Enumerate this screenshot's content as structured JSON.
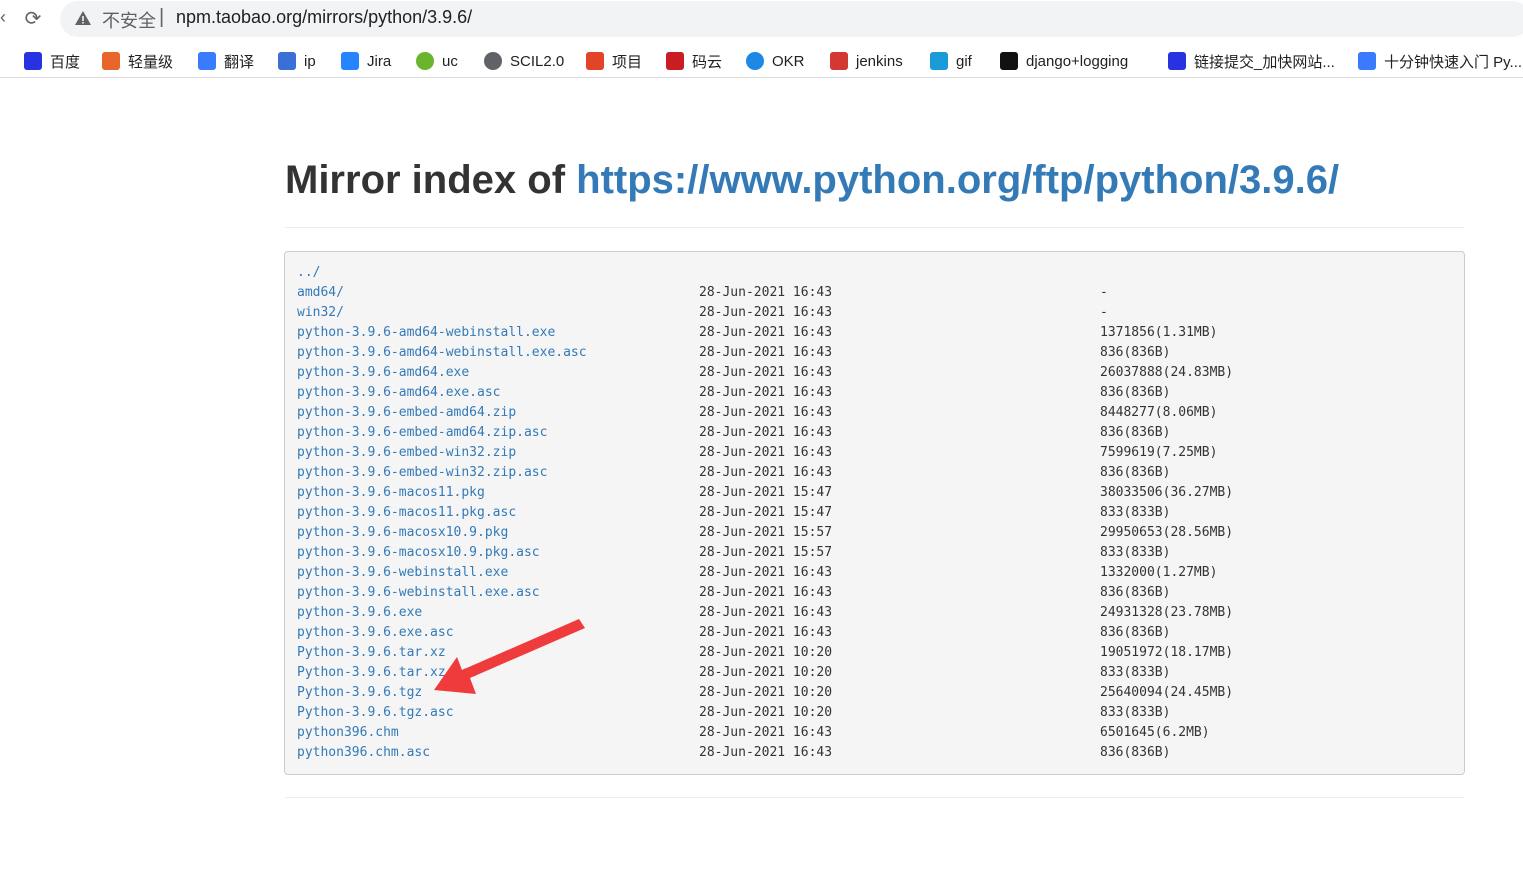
{
  "browser": {
    "security_label": "不安全",
    "address_separator": "|",
    "url": "npm.taobao.org/mirrors/python/3.9.6/"
  },
  "bookmarks": [
    {
      "label": "百度",
      "icon": "baidu-paw-icon",
      "color": "#2932e1"
    },
    {
      "label": "轻量级",
      "icon": "lightweight-icon",
      "color": "#e8652b"
    },
    {
      "label": "翻译",
      "icon": "translate-icon",
      "color": "#3a7bfd"
    },
    {
      "label": "ip",
      "icon": "ip-icon",
      "color": "#3a6fd8"
    },
    {
      "label": "Jira",
      "icon": "jira-icon",
      "color": "#2684ff"
    },
    {
      "label": "uc",
      "icon": "uc-icon",
      "color": "#6ab42e"
    },
    {
      "label": "SCIL2.0",
      "icon": "globe-icon",
      "color": "#5f6368"
    },
    {
      "label": "项目",
      "icon": "gitlab-icon",
      "color": "#e24329"
    },
    {
      "label": "码云",
      "icon": "gitee-icon",
      "color": "#c71d23"
    },
    {
      "label": "OKR",
      "icon": "okr-ring-icon",
      "color": "#1e88e5"
    },
    {
      "label": "jenkins",
      "icon": "jenkins-icon",
      "color": "#d33833"
    },
    {
      "label": "gif",
      "icon": "cloud-mountain-icon",
      "color": "#1a9bd7"
    },
    {
      "label": "django+logging",
      "icon": "django-site-icon",
      "color": "#111111"
    },
    {
      "label": "链接提交_加快网站...",
      "icon": "baidu-paw-icon",
      "color": "#2932e1"
    },
    {
      "label": "十分钟快速入门 Py...",
      "icon": "layers-icon",
      "color": "#3a7bfd"
    }
  ],
  "page": {
    "title_prefix": "Mirror index of",
    "title_link": "https://www.python.org/ftp/python/3.9.6/"
  },
  "listing": [
    {
      "name": "../",
      "date": "",
      "size": ""
    },
    {
      "name": "amd64/",
      "date": "28-Jun-2021 16:43",
      "size": "-"
    },
    {
      "name": "win32/",
      "date": "28-Jun-2021 16:43",
      "size": "-"
    },
    {
      "name": "python-3.9.6-amd64-webinstall.exe",
      "date": "28-Jun-2021 16:43",
      "size": "1371856(1.31MB)"
    },
    {
      "name": "python-3.9.6-amd64-webinstall.exe.asc",
      "date": "28-Jun-2021 16:43",
      "size": "836(836B)"
    },
    {
      "name": "python-3.9.6-amd64.exe",
      "date": "28-Jun-2021 16:43",
      "size": "26037888(24.83MB)"
    },
    {
      "name": "python-3.9.6-amd64.exe.asc",
      "date": "28-Jun-2021 16:43",
      "size": "836(836B)"
    },
    {
      "name": "python-3.9.6-embed-amd64.zip",
      "date": "28-Jun-2021 16:43",
      "size": "8448277(8.06MB)"
    },
    {
      "name": "python-3.9.6-embed-amd64.zip.asc",
      "date": "28-Jun-2021 16:43",
      "size": "836(836B)"
    },
    {
      "name": "python-3.9.6-embed-win32.zip",
      "date": "28-Jun-2021 16:43",
      "size": "7599619(7.25MB)"
    },
    {
      "name": "python-3.9.6-embed-win32.zip.asc",
      "date": "28-Jun-2021 16:43",
      "size": "836(836B)"
    },
    {
      "name": "python-3.9.6-macos11.pkg",
      "date": "28-Jun-2021 15:47",
      "size": "38033506(36.27MB)"
    },
    {
      "name": "python-3.9.6-macos11.pkg.asc",
      "date": "28-Jun-2021 15:47",
      "size": "833(833B)"
    },
    {
      "name": "python-3.9.6-macosx10.9.pkg",
      "date": "28-Jun-2021 15:57",
      "size": "29950653(28.56MB)"
    },
    {
      "name": "python-3.9.6-macosx10.9.pkg.asc",
      "date": "28-Jun-2021 15:57",
      "size": "833(833B)"
    },
    {
      "name": "python-3.9.6-webinstall.exe",
      "date": "28-Jun-2021 16:43",
      "size": "1332000(1.27MB)"
    },
    {
      "name": "python-3.9.6-webinstall.exe.asc",
      "date": "28-Jun-2021 16:43",
      "size": "836(836B)"
    },
    {
      "name": "python-3.9.6.exe",
      "date": "28-Jun-2021 16:43",
      "size": "24931328(23.78MB)"
    },
    {
      "name": "python-3.9.6.exe.asc",
      "date": "28-Jun-2021 16:43",
      "size": "836(836B)"
    },
    {
      "name": "Python-3.9.6.tar.xz",
      "date": "28-Jun-2021 10:20",
      "size": "19051972(18.17MB)"
    },
    {
      "name": "Python-3.9.6.tar.xz.asc",
      "date": "28-Jun-2021 10:20",
      "size": "833(833B)"
    },
    {
      "name": "Python-3.9.6.tgz",
      "date": "28-Jun-2021 10:20",
      "size": "25640094(24.45MB)"
    },
    {
      "name": "Python-3.9.6.tgz.asc",
      "date": "28-Jun-2021 10:20",
      "size": "833(833B)"
    },
    {
      "name": "python396.chm",
      "date": "28-Jun-2021 16:43",
      "size": "6501645(6.2MB)"
    },
    {
      "name": "python396.chm.asc",
      "date": "28-Jun-2021 16:43",
      "size": "836(836B)"
    }
  ],
  "annotation": {
    "color": "#ef3b3b",
    "icon": "red-arrow-annotation"
  }
}
